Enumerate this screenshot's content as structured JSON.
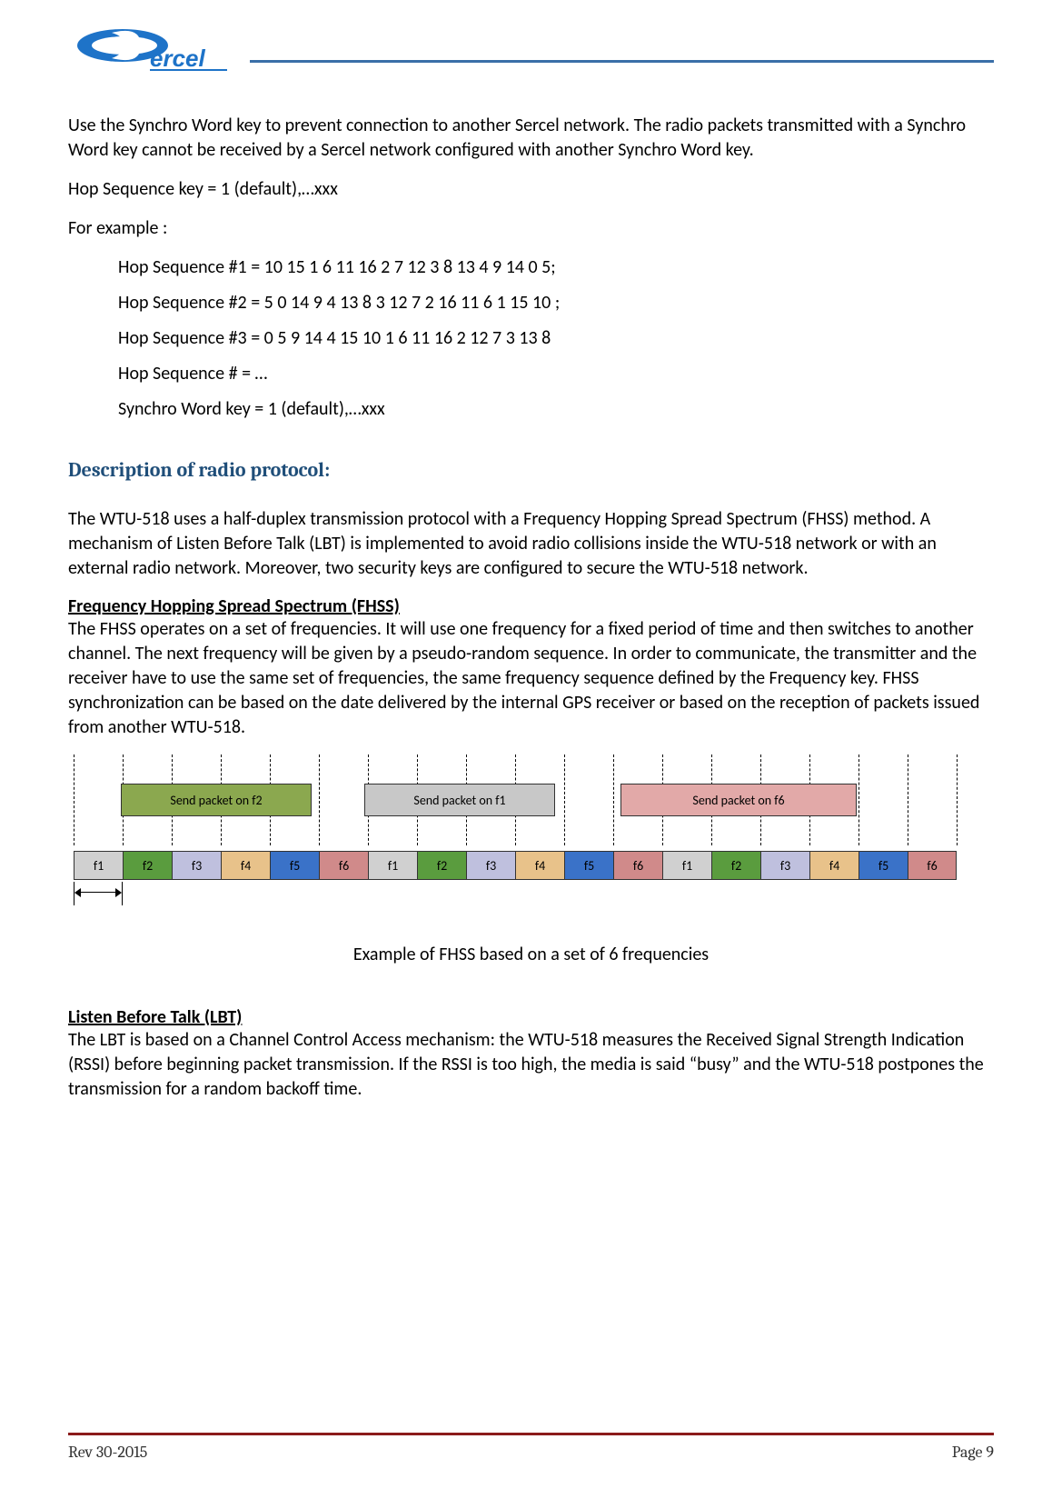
{
  "colors": {
    "header_line": "#3a6fa8",
    "footer_line": "#8b1a1a",
    "section_heading": "#1f4e79"
  },
  "logo_name": "Sercel",
  "para_intro": "Use the Synchro Word key to prevent connection to another Sercel network. The radio packets transmitted with a Synchro Word key cannot be received by a Sercel network configured with another Synchro Word key.",
  "hop_key_line": "Hop Sequence key = 1 (default),…xxx",
  "for_example": "For example :",
  "examples": [
    "Hop Sequence #1 = 10 15 1 6 11 16 2 7 12 3 8 13 4 9 14 0 5;",
    "Hop Sequence #2 = 5 0 14 9 4 13 8 3 12 7 2 16 11 6 1 15 10 ;",
    "Hop Sequence #3 = 0 5 9 14 4 15 10 1 6 11 16 2 12 7 3 13 8",
    "Hop Sequence # = …",
    "Synchro Word key = 1 (default),…xxx"
  ],
  "section_heading": "Description of radio protocol:",
  "para_proto": "The WTU-518 uses a half-duplex transmission protocol with a Frequency Hopping Spread Spectrum (FHSS) method. A mechanism of Listen Before Talk (LBT) is implemented to avoid radio collisions inside the WTU-518 network or with an external radio network. Moreover, two security keys are configured to secure the WTU-518 network.",
  "fhss_heading": "Frequency Hopping Spread Spectrum (FHSS)",
  "para_fhss": "The FHSS operates on a set of frequencies. It will use one frequency for a fixed period of time and then switches to another channel. The next frequency will be given by a pseudo-random sequence. In order to communicate, the transmitter and the receiver have to use the same set of frequencies, the same frequency sequence defined by the Frequency key. FHSS synchronization can be based on the date delivered by the internal GPS receiver or based on the reception of packets issued from another WTU-518.",
  "diagram": {
    "packets": [
      {
        "label": "Send packet on f2",
        "color": "green"
      },
      {
        "label": "Send packet on f1",
        "color": "gray"
      },
      {
        "label": "Send packet on f6",
        "color": "pink"
      }
    ],
    "freq_labels": [
      "f1",
      "f2",
      "f3",
      "f4",
      "f5",
      "f6"
    ],
    "freq_cycles": 3
  },
  "caption": "Example of FHSS based on a set of 6 frequencies",
  "lbt_heading": "Listen Before Talk (LBT)",
  "para_lbt": "The LBT is based on a Channel Control Access mechanism: the WTU-518 measures the Received Signal Strength Indication (RSSI) before beginning packet transmission. If the RSSI is too high, the media is said “busy” and the WTU-518 postpones the transmission for a random backoff time.",
  "footer": {
    "left": "Rev 30-2015",
    "right": "Page 9"
  }
}
